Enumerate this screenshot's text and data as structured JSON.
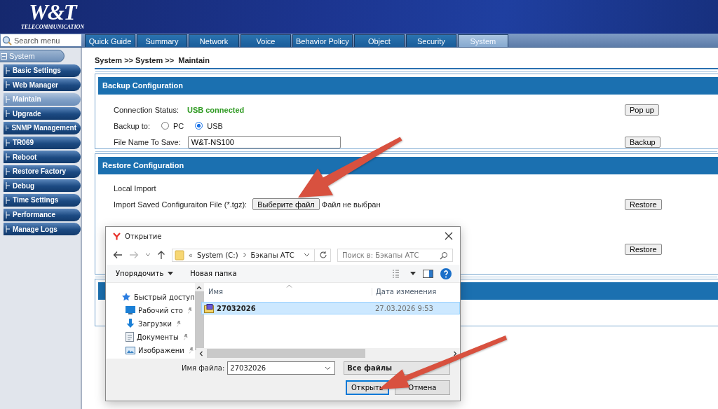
{
  "header": {
    "logo": "W&T",
    "tagline": "TELECOMMUNICATION"
  },
  "search": {
    "placeholder": "Search menu"
  },
  "tabs": [
    {
      "label": "Quick Guide",
      "selected": false
    },
    {
      "label": "Summary",
      "selected": false
    },
    {
      "label": "Network",
      "selected": false
    },
    {
      "label": "Voice",
      "selected": false
    },
    {
      "label": "Behavior Policy",
      "selected": false
    },
    {
      "label": "Object",
      "selected": false
    },
    {
      "label": "Security",
      "selected": false
    },
    {
      "label": "System",
      "selected": true
    }
  ],
  "sidebar": {
    "root": {
      "label": "System",
      "expanded": true
    },
    "items": [
      {
        "label": "Basic Settings",
        "selected": false
      },
      {
        "label": "Web Manager",
        "selected": false
      },
      {
        "label": "Maintain",
        "selected": true
      },
      {
        "label": "Upgrade",
        "selected": false
      },
      {
        "label": "SNMP Management",
        "selected": false
      },
      {
        "label": "TR069",
        "selected": false
      },
      {
        "label": "Reboot",
        "selected": false
      },
      {
        "label": "Restore Factory",
        "selected": false
      },
      {
        "label": "Debug",
        "selected": false
      },
      {
        "label": "Time Settings",
        "selected": false
      },
      {
        "label": "Performance",
        "selected": false
      },
      {
        "label": "Manage Logs",
        "selected": false
      }
    ]
  },
  "breadcrumb": "System >> System >>  Maintain",
  "backup": {
    "title": "Backup Configuration",
    "status_label": "Connection Status:",
    "status": "USB connected",
    "backup_to_label": "Backup to:",
    "targets": [
      {
        "label": "PC",
        "selected": false
      },
      {
        "label": "USB",
        "selected": true
      }
    ],
    "file_label": "File Name To Save:",
    "file_name": "W&T-NS100",
    "popup_button": "Pop up",
    "backup_button": "Backup"
  },
  "restore": {
    "title": "Restore Configuration",
    "local_import": "Local Import",
    "import_label": "Import Saved Configuraiton File (*.tgz):",
    "choose_button": "Выберите файл",
    "no_file": "Файл не выбран",
    "restore_buttons": [
      "Restore",
      "Restore"
    ]
  },
  "dialog": {
    "title": "Открытие",
    "path_prefix": "«",
    "path": [
      "System (C:)",
      "Бэкапы АТС"
    ],
    "search_placeholder": "Поиск в: Бэкапы АТС",
    "organize": "Упорядочить",
    "new_folder": "Новая папка",
    "nav_items": [
      {
        "label": "Быстрый доступ",
        "kind": "star",
        "pinned": false
      },
      {
        "label": "Рабочий сто",
        "kind": "desktop",
        "pinned": true
      },
      {
        "label": "Загрузки",
        "kind": "download",
        "pinned": true
      },
      {
        "label": "Документы",
        "kind": "document",
        "pinned": true
      },
      {
        "label": "Изображени",
        "kind": "picture",
        "pinned": true
      }
    ],
    "columns": [
      "Имя",
      "Дата изменения"
    ],
    "files": [
      {
        "name": "27032026",
        "date": "27.03.2026 9:53",
        "selected": true
      }
    ],
    "file_name_label": "Имя файла:",
    "file_name": "27032026",
    "file_type": "Все файлы",
    "open_button": "Открыть",
    "cancel_button": "Отмена"
  }
}
